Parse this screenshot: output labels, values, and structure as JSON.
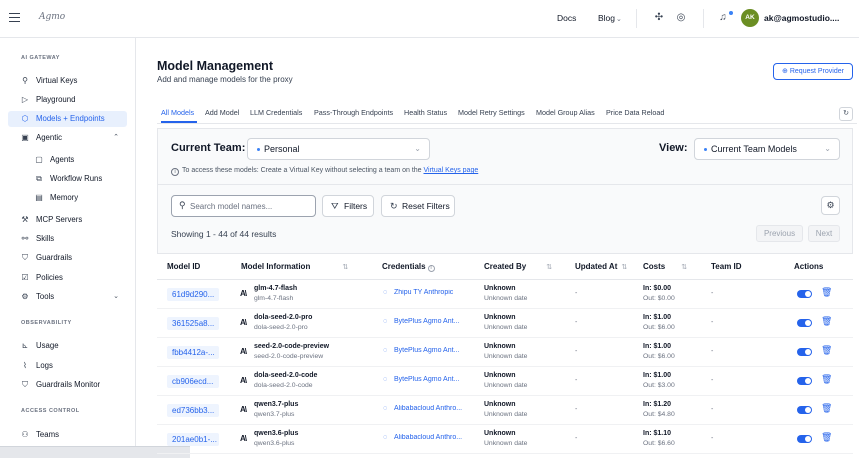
{
  "header": {
    "logo": "Agmo",
    "docs": "Docs",
    "blog": "Blog",
    "avatar_initials": "AK",
    "user_email": "ak@agmostudio...."
  },
  "sidebar": {
    "sections": [
      {
        "label": "AI GATEWAY"
      },
      {
        "label": "OBSERVABILITY"
      },
      {
        "label": "ACCESS CONTROL"
      }
    ],
    "items": [
      {
        "label": "Virtual Keys",
        "icon": "key-icon"
      },
      {
        "label": "Playground",
        "icon": "play-icon"
      },
      {
        "label": "Models + Endpoints",
        "icon": "cube-icon",
        "active": true
      },
      {
        "label": "Agentic",
        "icon": "agent-icon",
        "expanded": true
      },
      {
        "label": "Agents",
        "icon": "robot-icon"
      },
      {
        "label": "Workflow Runs",
        "icon": "workflow-icon"
      },
      {
        "label": "Memory",
        "icon": "memory-icon"
      },
      {
        "label": "MCP Servers",
        "icon": "tool-icon"
      },
      {
        "label": "Skills",
        "icon": "wand-icon"
      },
      {
        "label": "Guardrails",
        "icon": "shield-icon"
      },
      {
        "label": "Policies",
        "icon": "policy-icon"
      },
      {
        "label": "Tools",
        "icon": "wrench-icon"
      },
      {
        "label": "Usage",
        "icon": "chart-icon"
      },
      {
        "label": "Logs",
        "icon": "logs-icon"
      },
      {
        "label": "Guardrails Monitor",
        "icon": "shield-check-icon"
      },
      {
        "label": "Teams",
        "icon": "teams-icon"
      }
    ]
  },
  "main": {
    "title": "Model Management",
    "subtitle": "Add and manage models for the proxy",
    "request_provider": "Request Provider",
    "tabs": [
      {
        "label": "All Models"
      },
      {
        "label": "Add Model"
      },
      {
        "label": "LLM Credentials"
      },
      {
        "label": "Pass-Through Endpoints"
      },
      {
        "label": "Health Status"
      },
      {
        "label": "Model Retry Settings"
      },
      {
        "label": "Model Group Alias"
      },
      {
        "label": "Price Data Reload"
      }
    ],
    "current_team_label": "Current Team:",
    "current_team_value": "Personal",
    "view_label": "View:",
    "view_value": "Current Team Models",
    "info_text": "To access these models: Create a Virtual Key without selecting a team on the ",
    "info_link": "Virtual Keys page",
    "search_placeholder": "Search model names...",
    "filters_label": "Filters",
    "reset_filters_label": "Reset Filters",
    "results_text": "Showing 1 - 44 of 44 results",
    "previous_label": "Previous",
    "next_label": "Next"
  },
  "table": {
    "headers": [
      "Model ID",
      "Model Information",
      "Credentials",
      "Created By",
      "Updated At",
      "Costs",
      "Team ID",
      "Actions"
    ],
    "rows": [
      {
        "id": "61d9d290...",
        "name": "glm-4.7-flash",
        "sub": "glm-4.7-flash",
        "cred": "Zhipu TY Anthropic",
        "by": "Unknown",
        "date": "Unknown date",
        "updated": "-",
        "cin": "In: $0.00",
        "cout": "Out: $0.00",
        "team": "-"
      },
      {
        "id": "361525a8...",
        "name": "dola-seed-2.0-pro",
        "sub": "dola-seed-2.0-pro",
        "cred": "BytePlus Agmo Ant...",
        "by": "Unknown",
        "date": "Unknown date",
        "updated": "-",
        "cin": "In: $1.00",
        "cout": "Out: $6.00",
        "team": "-"
      },
      {
        "id": "fbb4412a-...",
        "name": "seed-2.0-code-preview",
        "sub": "seed-2.0-code-preview",
        "cred": "BytePlus Agmo Ant...",
        "by": "Unknown",
        "date": "Unknown date",
        "updated": "-",
        "cin": "In: $1.00",
        "cout": "Out: $6.00",
        "team": "-"
      },
      {
        "id": "cb906ecd...",
        "name": "dola-seed-2.0-code",
        "sub": "dola-seed-2.0-code",
        "cred": "BytePlus Agmo Ant...",
        "by": "Unknown",
        "date": "Unknown date",
        "updated": "-",
        "cin": "In: $1.00",
        "cout": "Out: $3.00",
        "team": "-"
      },
      {
        "id": "ed736bb3...",
        "name": "qwen3.7-plus",
        "sub": "qwen3.7-plus",
        "cred": "Alibabacloud Anthro...",
        "by": "Unknown",
        "date": "Unknown date",
        "updated": "-",
        "cin": "In: $1.20",
        "cout": "Out: $4.80",
        "team": "-"
      },
      {
        "id": "201ae0b1-...",
        "name": "qwen3.6-plus",
        "sub": "qwen3.6-plus",
        "cred": "Alibabacloud Anthro...",
        "by": "Unknown",
        "date": "Unknown date",
        "updated": "-",
        "cin": "In: $1.10",
        "cout": "Out: $6.60",
        "team": "-"
      }
    ]
  },
  "colors": {
    "accent": "#2563eb",
    "active_bg": "#e8f0fd"
  }
}
